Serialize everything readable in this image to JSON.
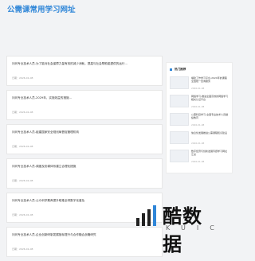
{
  "header": {
    "title": "公需课常用学习网址"
  },
  "articles": [
    {
      "title": "问问专业技术人员-为了能对社会保障力量有效的减少消耗，提高与社会帮助能提供的运行...",
      "date": "日期：2026-01-08"
    },
    {
      "title": "问问专业技术人员-2029年，实施效益的措施...",
      "date": "日期：2026-01-08"
    },
    {
      "title": "问问专业技术人员-组建国家安全规划局督促管理机构",
      "date": "日期：2026-01-08"
    },
    {
      "title": "问问专业技术人员-调度及协调体系建立合理化措施",
      "date": "日期：2026-01-08"
    },
    {
      "title": "问问专业技术人员-公众科学素养提升助推全球数字化普及",
      "date": "日期：2026-01-08"
    },
    {
      "title": "问问专业技术人员-企业创新研制发展指标提升与合作融合战略研究",
      "date": "日期：2026-01-08"
    }
  ],
  "sidebar": {
    "widget_title": "热门推荐",
    "items": [
      {
        "title": "福建工作学习平台-2024年的课程全国统一查询服务",
        "date": "2026-01-08"
      },
      {
        "title": "网络学习-推进全面高效的网络学习相关认证平台",
        "date": "2026-01-08"
      },
      {
        "title": "公需科目学习-全国专业技术人员继续教育",
        "date": "2026-01-08"
      },
      {
        "title": "信息化发展推进公需课程知识建设",
        "date": "2026-01-08"
      },
      {
        "title": "数字经济与创新发展专题学习网址汇总",
        "date": "2026-01-08"
      }
    ]
  },
  "watermark": {
    "name": "酷数据",
    "subtitle": "KUIC"
  },
  "colors": {
    "accent": "#2f86d8",
    "background": "#f2f3f5"
  }
}
